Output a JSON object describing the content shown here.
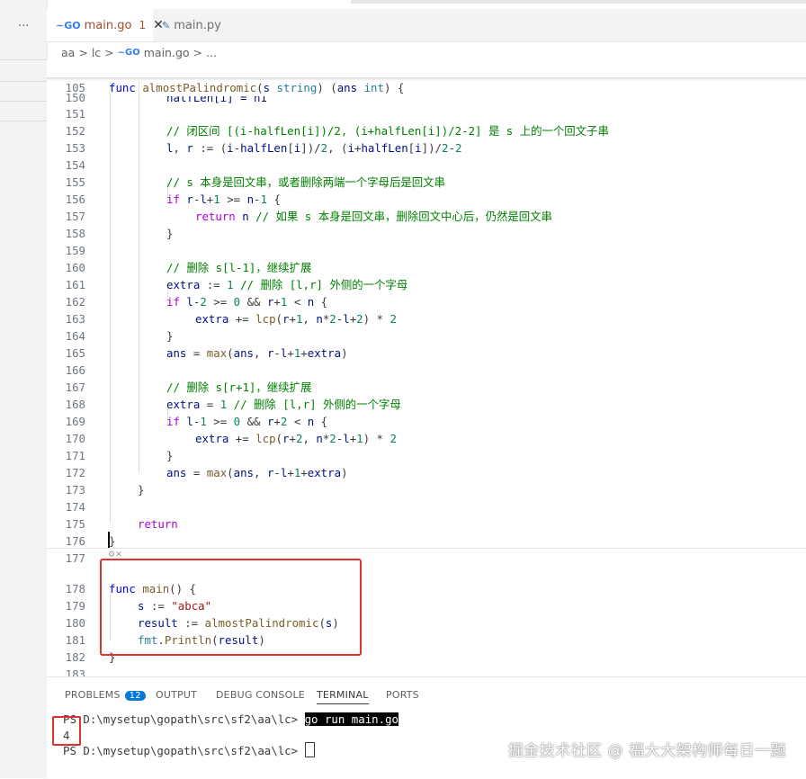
{
  "window": {
    "more_label": "···"
  },
  "tabs": [
    {
      "icon": "go-icon",
      "label": "main.go",
      "badge": "1",
      "close": "✕"
    },
    {
      "icon": "python-icon",
      "label": "main.py"
    }
  ],
  "breadcrumb": {
    "parts": [
      "aa",
      "lc",
      "main.go",
      "..."
    ],
    "sep": ">"
  },
  "sticky": {
    "line": "105",
    "name": "almostPalindromic",
    "param": "s",
    "ptype": "string",
    "ret": "ans",
    "rtype": "int"
  },
  "editor": {
    "partial_line": "halfLen[i] = n1",
    "lines": {
      "l151": "151",
      "l152": "152",
      "l153": "153",
      "l154": "154",
      "l155": "155",
      "l156": "156",
      "l157": "157",
      "l158": "158",
      "l159": "159",
      "l160": "160",
      "l161": "161",
      "l162": "162",
      "l163": "163",
      "l164": "164",
      "l165": "165",
      "l166": "166",
      "l167": "167",
      "l168": "168",
      "l169": "169",
      "l170": "170",
      "l171": "171",
      "l172": "172",
      "l173": "173",
      "l174": "174",
      "l175": "175",
      "l176": "176",
      "l177": "177",
      "l178": "178",
      "l179": "179",
      "l180": "180",
      "l181": "181",
      "l182": "182",
      "l183": "183"
    },
    "comments": {
      "c152": "// 闭区间 [(i-halfLen[i])/2, (i+halfLen[i])/2-2] 是 s 上的一个回文子串",
      "c155": "// s 本身是回文串，或者删除两端一个字母后是回文串",
      "c157": "// 如果 s 本身是回文串，删除回文中心后，仍然是回文串",
      "c160": "// 删除 s[l-1]，继续扩展",
      "c161": "// 删除 [l,r] 外侧的一个字母",
      "c167": "// 删除 s[r+1]，继续扩展",
      "c168": "// 删除 [l,r] 外侧的一个字母"
    },
    "strings": {
      "abca": "\"abca\""
    }
  },
  "panel": {
    "tabs": [
      "PROBLEMS",
      "OUTPUT",
      "DEBUG CONSOLE",
      "TERMINAL",
      "PORTS"
    ],
    "problems_count": "12",
    "terminal": {
      "prompt1": "PS D:\\mysetup\\gopath\\src\\sf2\\aa\\lc> ",
      "cmd_go": "go",
      "cmd_rest": " run main.go",
      "output": "4",
      "prompt2": "PS D:\\mysetup\\gopath\\src\\sf2\\aa\\lc> "
    }
  },
  "watermark": "掘金技术社区 @ 福大大架构师每日一题",
  "colors": {
    "annotation_red": "#e03131",
    "keyword": "#0000ff",
    "function": "#795e26",
    "comment": "#008000",
    "badge_blue": "#0078d4"
  }
}
